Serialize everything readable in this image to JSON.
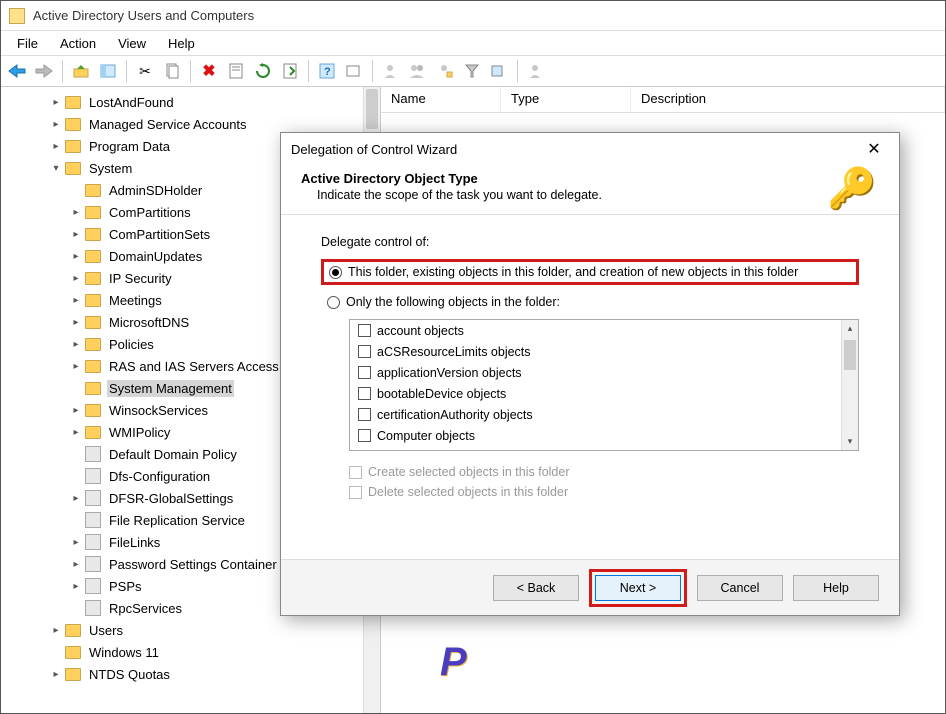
{
  "app": {
    "title": "Active Directory Users and Computers"
  },
  "menubar": {
    "file": "File",
    "action": "Action",
    "view": "View",
    "help": "Help"
  },
  "list": {
    "cols": {
      "name": "Name",
      "type": "Type",
      "description": "Description"
    }
  },
  "tree": {
    "items": [
      {
        "label": "LostAndFound",
        "indent": 2,
        "expander": "▸",
        "icon": "folder"
      },
      {
        "label": "Managed Service Accounts",
        "indent": 2,
        "expander": "▸",
        "icon": "folder"
      },
      {
        "label": "Program Data",
        "indent": 2,
        "expander": "▸",
        "icon": "folder"
      },
      {
        "label": "System",
        "indent": 2,
        "expander": "▾",
        "icon": "folder"
      },
      {
        "label": "AdminSDHolder",
        "indent": 3,
        "expander": "",
        "icon": "folder"
      },
      {
        "label": "ComPartitions",
        "indent": 3,
        "expander": "▸",
        "icon": "folder"
      },
      {
        "label": "ComPartitionSets",
        "indent": 3,
        "expander": "▸",
        "icon": "folder"
      },
      {
        "label": "DomainUpdates",
        "indent": 3,
        "expander": "▸",
        "icon": "folder"
      },
      {
        "label": "IP Security",
        "indent": 3,
        "expander": "▸",
        "icon": "folder"
      },
      {
        "label": "Meetings",
        "indent": 3,
        "expander": "▸",
        "icon": "folder"
      },
      {
        "label": "MicrosoftDNS",
        "indent": 3,
        "expander": "▸",
        "icon": "folder"
      },
      {
        "label": "Policies",
        "indent": 3,
        "expander": "▸",
        "icon": "folder"
      },
      {
        "label": "RAS and IAS Servers Access",
        "indent": 3,
        "expander": "▸",
        "icon": "folder"
      },
      {
        "label": "System Management",
        "indent": 3,
        "expander": "",
        "icon": "folder",
        "selected": true
      },
      {
        "label": "WinsockServices",
        "indent": 3,
        "expander": "▸",
        "icon": "folder"
      },
      {
        "label": "WMIPolicy",
        "indent": 3,
        "expander": "▸",
        "icon": "folder"
      },
      {
        "label": "Default Domain Policy",
        "indent": 3,
        "expander": "",
        "icon": "generic"
      },
      {
        "label": "Dfs-Configuration",
        "indent": 3,
        "expander": "",
        "icon": "generic"
      },
      {
        "label": "DFSR-GlobalSettings",
        "indent": 3,
        "expander": "▸",
        "icon": "generic"
      },
      {
        "label": "File Replication Service",
        "indent": 3,
        "expander": "",
        "icon": "generic"
      },
      {
        "label": "FileLinks",
        "indent": 3,
        "expander": "▸",
        "icon": "generic"
      },
      {
        "label": "Password Settings Container",
        "indent": 3,
        "expander": "▸",
        "icon": "generic"
      },
      {
        "label": "PSPs",
        "indent": 3,
        "expander": "▸",
        "icon": "generic"
      },
      {
        "label": "RpcServices",
        "indent": 3,
        "expander": "",
        "icon": "generic"
      },
      {
        "label": "Users",
        "indent": 2,
        "expander": "▸",
        "icon": "folder"
      },
      {
        "label": "Windows 11",
        "indent": 2,
        "expander": "",
        "icon": "folder"
      },
      {
        "label": "NTDS Quotas",
        "indent": 2,
        "expander": "▸",
        "icon": "folder"
      }
    ]
  },
  "wizard": {
    "title": "Delegation of Control Wizard",
    "heading": "Active Directory Object Type",
    "subheading": "Indicate the scope of the task you want to delegate.",
    "group_label": "Delegate control of:",
    "radio1": "This folder, existing objects in this folder, and creation of new objects in this folder",
    "radio2": "Only the following objects in the folder:",
    "objects": [
      "account objects",
      "aCSResourceLimits objects",
      "applicationVersion objects",
      "bootableDevice objects",
      "certificationAuthority objects",
      "Computer objects"
    ],
    "sub1": "Create selected objects in this folder",
    "sub2": "Delete selected objects in this folder",
    "buttons": {
      "back": "< Back",
      "next": "Next >",
      "cancel": "Cancel",
      "help": "Help"
    }
  },
  "watermark": "P"
}
